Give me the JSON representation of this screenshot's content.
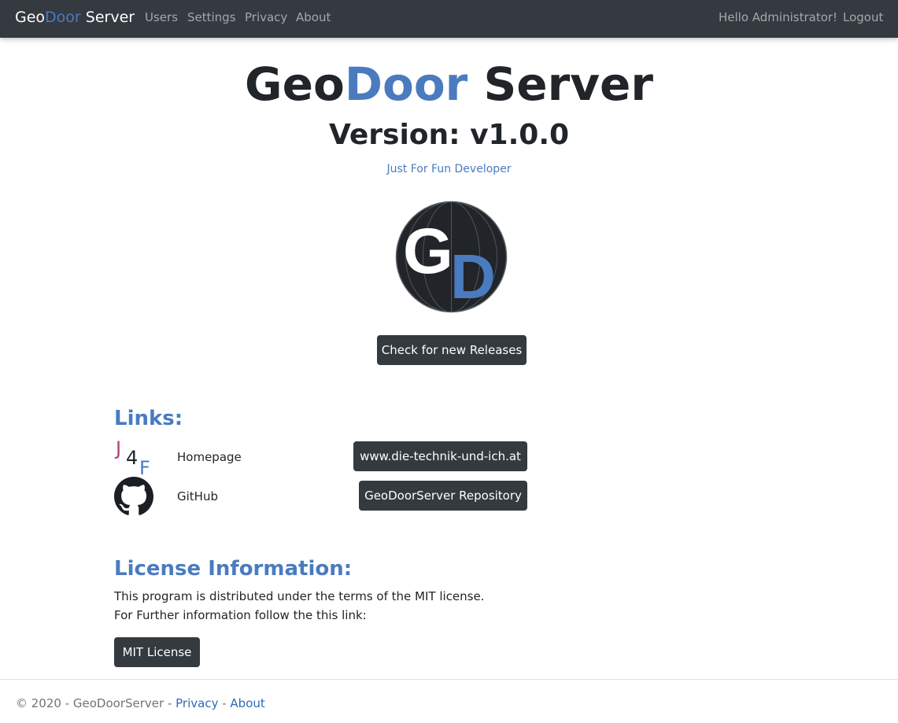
{
  "navbar": {
    "brand_geo": "Geo",
    "brand_door": "Door",
    "brand_server": " Server",
    "links": [
      "Users",
      "Settings",
      "Privacy",
      "About"
    ],
    "greeting": "Hello Administrator!",
    "logout": "Logout"
  },
  "hero": {
    "title_geo": "Geo",
    "title_door": "Door",
    "title_server": " Server",
    "version": "Version: v1.0.0",
    "developer": "Just For Fun Developer",
    "logo_letters": [
      "G",
      "D"
    ],
    "check_releases": "Check for new Releases"
  },
  "links": {
    "title": "Links:",
    "items": [
      {
        "label": "Homepage",
        "button": "www.die-technik-und-ich.at",
        "icon": "j4f-logo-icon"
      },
      {
        "label": "GitHub",
        "button": "GeoDoorServer Repository",
        "icon": "github-icon"
      }
    ],
    "j4f_letters": [
      "J",
      "4",
      "F"
    ]
  },
  "license": {
    "title": "License Information:",
    "line1": "This program is distributed under the terms of the MIT license.",
    "line2": "For Further information follow the this link:",
    "button": "MIT License"
  },
  "footer": {
    "copyright": "© 2020 - GeoDoorServer - ",
    "privacy": "Privacy",
    "separator": " - ",
    "about": "About"
  },
  "colors": {
    "accent": "#4a7bbf",
    "navbar_bg": "#343a40",
    "button_bg": "#343a40"
  }
}
